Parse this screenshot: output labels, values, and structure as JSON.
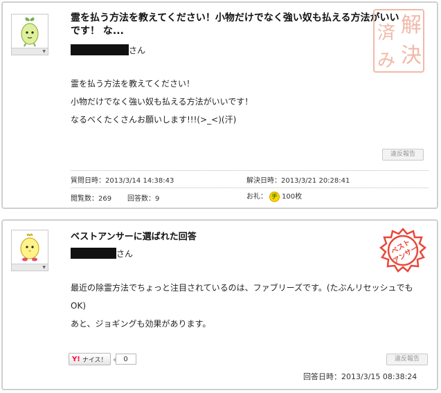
{
  "question": {
    "title": "霊を払う方法を教えてください！小物だけでなく強い奴も払える方法がいいです！ な...",
    "user_suffix": "さん",
    "body_lines": [
      "霊を払う方法を教えてください！",
      "小物だけでなく強い奴も払える方法がいいです！",
      "なるべくたくさんお願いします!!!(>_<)(汗)"
    ],
    "report_label": "違反報告",
    "posted_label": "質問日時：2013/3/14 14:38:43",
    "resolved_label": "解決日時：2013/3/21 20:28:41",
    "views_label": "閲覧数：269",
    "answers_label": "回答数：9",
    "reward_label": "お礼：",
    "coin_glyph": "チ",
    "reward_value": "100枚",
    "solved_stamp": [
      "解",
      "決",
      "済",
      "み"
    ]
  },
  "best_answer": {
    "heading": "ベストアンサーに選ばれた回答",
    "user_suffix": "さん",
    "body_lines": [
      "最近の除霊方法でちょっと注目されているのは、ファブリーズです。(たぶんリセッシュでも",
      "OK)",
      "あと、ジョギングも効果があります。"
    ],
    "stamp_text": [
      "ベスト",
      "アンサー"
    ],
    "nice_logo": "Y!",
    "nice_label": "ナイス！",
    "nice_count": "0",
    "report_label": "違反報告",
    "answered_label": "回答日時：2013/3/15 08:38:24"
  },
  "colors": {
    "stamp_red": "#e8473a",
    "solved_stamp": "#f2b8a8",
    "border": "#cfcfcf"
  }
}
